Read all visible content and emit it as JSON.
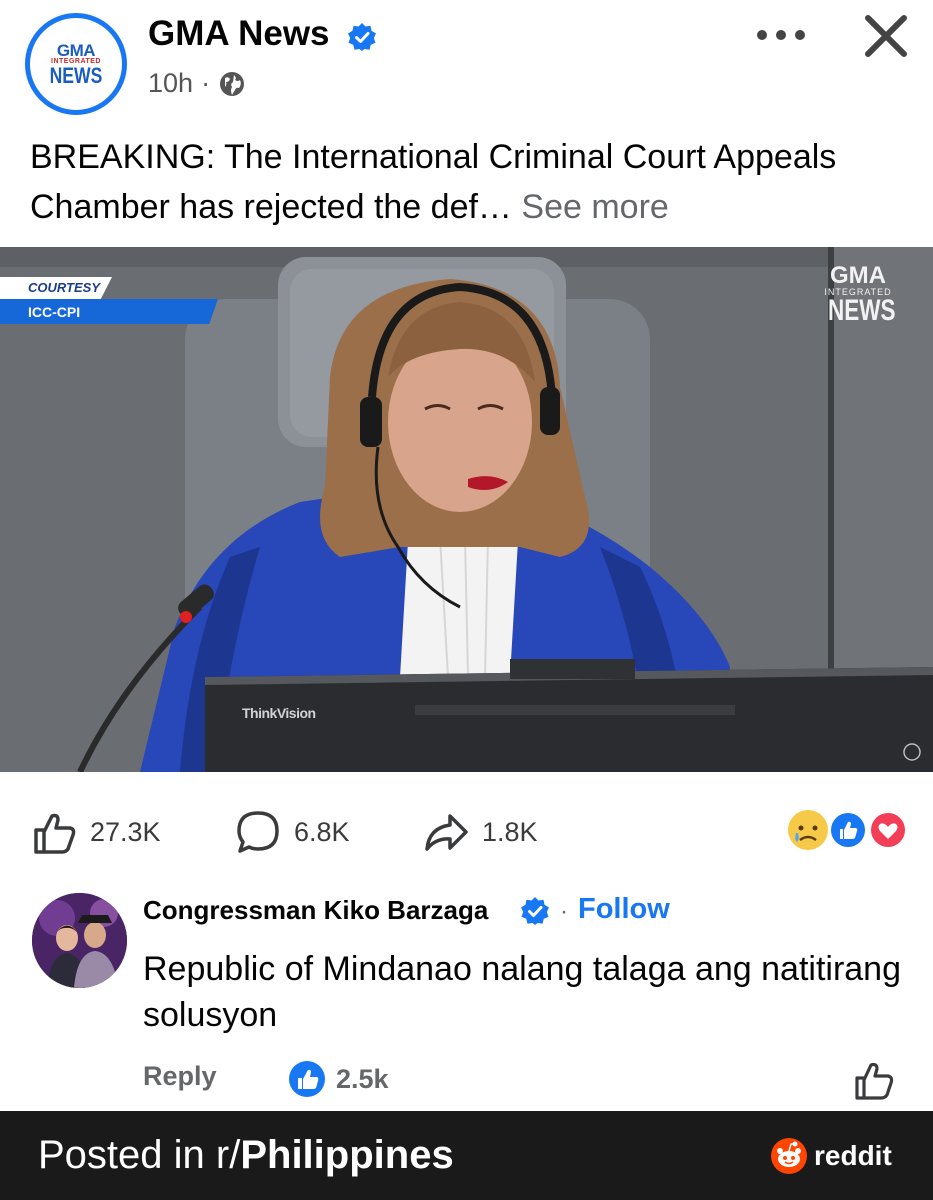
{
  "post": {
    "page_name": "GMA News",
    "avatar": {
      "line1": "GMA",
      "line2": "INTEGRATED",
      "line3": "NEWS"
    },
    "time": "10h",
    "separator": "·",
    "text": "BREAKING: The International Criminal Court Appeals Chamber has rejected the def…",
    "see_more": "See more"
  },
  "media": {
    "courtesy_label": "COURTESY",
    "courtesy_source": "ICC-CPI",
    "watermark": {
      "line1": "GMA",
      "line2": "INTEGRATED",
      "line3": "NEWS"
    },
    "monitor_brand": "ThinkVision"
  },
  "engagement": {
    "likes": "27.3K",
    "comments": "6.8K",
    "shares": "1.8K",
    "reactions": [
      "sad",
      "like",
      "love"
    ]
  },
  "comment": {
    "author": "Congressman Kiko Barzaga",
    "separator": "·",
    "follow_label": "Follow",
    "text": "Republic of Mindanao nalang talaga ang natitirang solusyon",
    "reply_label": "Reply",
    "likes": "2.5k"
  },
  "footer": {
    "posted_in": "Posted in r/",
    "subreddit": "Philippines",
    "brand": "reddit"
  },
  "colors": {
    "facebook_blue": "#1877f2",
    "footer_bg": "#1a1a1b",
    "robe_blue": "#2847b8",
    "reddit_orange": "#ff4500"
  }
}
